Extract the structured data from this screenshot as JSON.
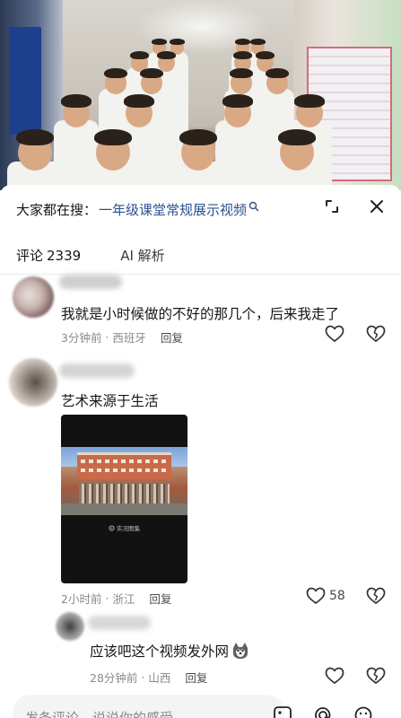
{
  "search": {
    "prefix": "大家都在搜：",
    "query": "一年级课堂常规展示视频"
  },
  "tabs": [
    {
      "label": "评论",
      "count": "2339"
    },
    {
      "label": "AI 解析"
    }
  ],
  "comments": [
    {
      "text": "我就是小时候做的不好的那几个，后来我走了",
      "time": "3分钟前",
      "location": "西班牙",
      "reply_label": "回复",
      "likes": ""
    },
    {
      "text": "艺术来源于生活",
      "time": "2小时前",
      "location": "浙江",
      "reply_label": "回复",
      "likes": "58",
      "media_badge": "实况图集"
    },
    {
      "text": "应该吧这个视频发外网",
      "time": "28分钟前",
      "location": "山西",
      "reply_label": "回复",
      "likes": ""
    }
  ],
  "composer": {
    "placeholder": "发条评论，说说你的感受"
  },
  "icons": {
    "search_link": "search-icon",
    "expand": "expand-icon",
    "close": "close-icon",
    "like": "heart-icon",
    "dislike": "broken-heart-icon",
    "emoji": "emoji-icon",
    "mention": "at-icon",
    "image": "image-icon"
  },
  "colors": {
    "link": "#2c5190",
    "meta": "#8a8a8a",
    "text": "#161616"
  }
}
